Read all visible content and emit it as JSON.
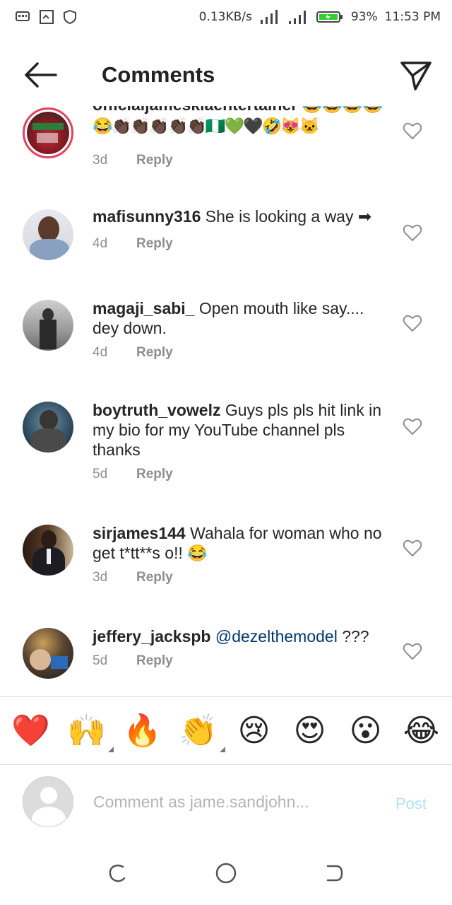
{
  "status_bar": {
    "speed": "0.13KB/s",
    "battery": "93%",
    "time": "11:53 PM"
  },
  "header": {
    "title": "Comments"
  },
  "comments": [
    {
      "username": "officialjamesklaentertainer",
      "text": "😂👏🏿👏🏿👏🏿👏🏿👏🏿🇳🇬💚🖤🤣😻🐱",
      "time": "3d",
      "reply": "Reply"
    },
    {
      "username": "mafisunny316",
      "text": "She is looking a way ➡",
      "time": "4d",
      "reply": "Reply"
    },
    {
      "username": "magaji_sabi_",
      "text": "Open mouth like say.... dey down.",
      "time": "4d",
      "reply": "Reply"
    },
    {
      "username": "boytruth_vowelz",
      "text": "Guys pls pls hit link in my bio for my YouTube channel pls thanks",
      "time": "5d",
      "reply": "Reply"
    },
    {
      "username": "sirjames144",
      "text": "Wahala for woman who no get t*tt**s o!! 😂",
      "time": "3d",
      "reply": "Reply"
    },
    {
      "username": "jeffery_jackspb",
      "mention": "@dezelthemodel",
      "text": " ???",
      "time": "5d",
      "reply": "Reply"
    }
  ],
  "emoji_bar": [
    "❤️",
    "🙌",
    "🔥",
    "👏",
    "😢",
    "😍",
    "😮",
    "😂"
  ],
  "input": {
    "placeholder": "Comment as jame.sandjohn...",
    "post_label": "Post"
  },
  "colors": {
    "post_disabled": "#b2dffc",
    "mention": "#00376b",
    "story_ring": "#e4405f"
  }
}
